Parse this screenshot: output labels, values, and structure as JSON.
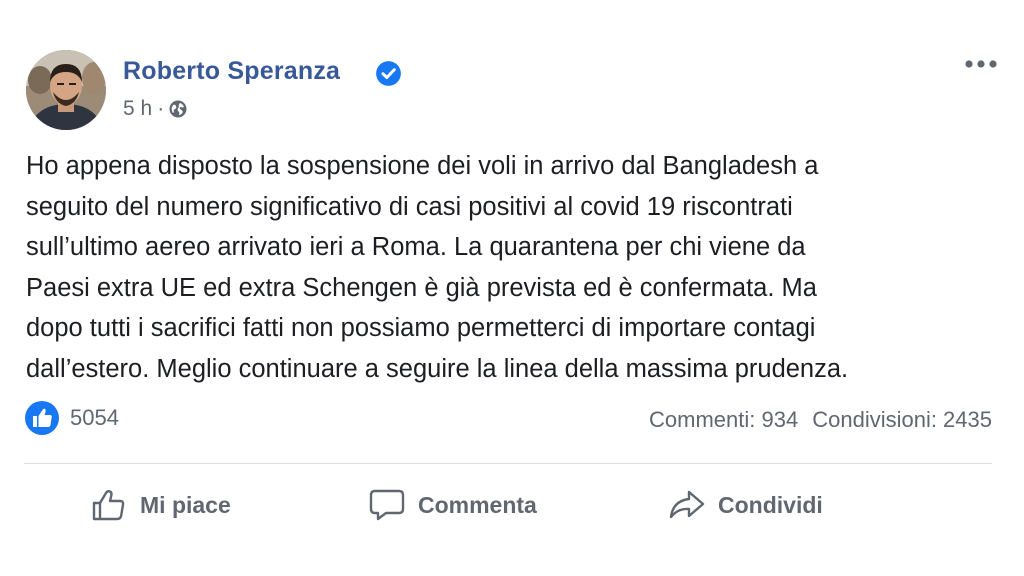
{
  "post": {
    "author": "Roberto Speranza",
    "time": "5 h",
    "separator": "·",
    "privacy_icon": "globe-icon",
    "verified_icon": "verified-badge-icon",
    "more_icon": "more-options-icon",
    "text": "Ho appena disposto la sospensione dei voli in arrivo dal Bangladesh a\nseguito del numero significativo di casi positivi al covid 19 riscontrati\nsull’ultimo aereo arrivato ieri a Roma. La quarantena per chi viene da\nPaesi extra UE ed extra Schengen è già prevista ed è confermata. Ma\ndopo tutti i sacrifici fatti non possiamo permetterci di importare contagi\ndall’estero. Meglio continuare a seguire la linea della massima prudenza."
  },
  "stats": {
    "reactions": "5054",
    "comments": "Commenti: 934",
    "shares": "Condivisioni: 2435"
  },
  "actions": {
    "like": "Mi piace",
    "comment": "Commenta",
    "share": "Condividi"
  },
  "colors": {
    "name_blue": "#385898",
    "verified_blue": "#1877f2",
    "secondary_text": "#606770",
    "body_text": "#1c1e21",
    "divider": "#dadde1"
  }
}
